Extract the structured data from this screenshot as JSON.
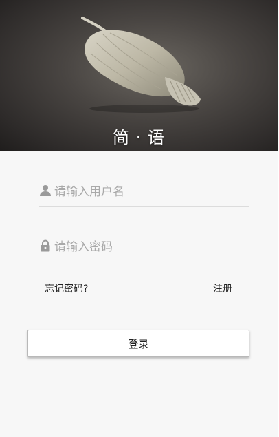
{
  "header": {
    "title": "简 · 语"
  },
  "form": {
    "username": {
      "value": "",
      "placeholder": "请输入用户名",
      "icon": "user-icon"
    },
    "password": {
      "value": "",
      "placeholder": "请输入密码",
      "icon": "lock-icon"
    },
    "forgot_label": "忘记密码?",
    "register_label": "注册",
    "login_label": "登录"
  },
  "colors": {
    "background": "#f7f7f7",
    "icon": "#9a9a9a",
    "divider": "#dcdcdc"
  }
}
